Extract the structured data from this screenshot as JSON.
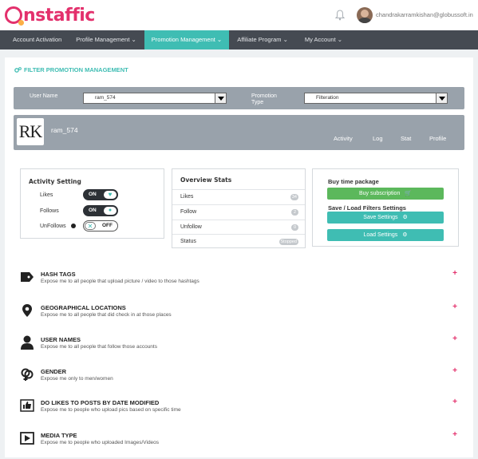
{
  "brand": {
    "logo_text": "nstaffic",
    "logo_icon": "instagram-ring-icon",
    "accent": "#e3306c"
  },
  "header": {
    "user_email": "chandrakarramkishan@globussoft.in",
    "bell_icon": "bell-icon"
  },
  "nav": {
    "items": [
      {
        "label": "Account Activation"
      },
      {
        "label": "Profile Management  ⌄"
      },
      {
        "label": "Promotion Management  ⌄"
      },
      {
        "label": "Affiliate Program  ⌄"
      },
      {
        "label": "My Account  ⌄"
      }
    ],
    "active_color": "#3fbdb3"
  },
  "filter": {
    "title": "FILTER PROMOTION MANAGEMENT",
    "user_name_label": "User Name",
    "user_name_value": "ram_574",
    "promotion_type_label": "Promotion Type",
    "promotion_type_value": "Filteration"
  },
  "profile": {
    "avatar_text": "RK",
    "name": "ram_574",
    "tabs": [
      "Activity",
      "Log",
      "Stat",
      "Profile"
    ]
  },
  "activity": {
    "title": "Activity Setting",
    "rows": [
      {
        "label": "Likes",
        "state": "ON"
      },
      {
        "label": "Follows",
        "state": "ON"
      },
      {
        "label": "UnFollows",
        "state": "OFF"
      }
    ]
  },
  "overview": {
    "title": "Overview Stats",
    "rows": [
      {
        "label": "Likes",
        "value": "34"
      },
      {
        "label": "Follow",
        "value": "2"
      },
      {
        "label": "Unfollow",
        "value": "0"
      },
      {
        "label": "Status",
        "value": "Stopped"
      }
    ]
  },
  "buy": {
    "title": "Buy time package",
    "subscribe_label": "Buy subscription",
    "save_load_title": "Save / Load Filters Settings",
    "save_label": "Save Settings",
    "load_label": "Load Settings",
    "green": "#5cb85c",
    "teal": "#3fbdb3"
  },
  "features": [
    {
      "title": "HASH TAGS",
      "desc": "Expose me to all people that upload picture / video to those hashtags",
      "icon": "tag-icon"
    },
    {
      "title": "GEOGRAPHICAL LOCATIONS",
      "desc": "Expose me to all people that did check in at those places",
      "icon": "map-pin-icon"
    },
    {
      "title": "USER NAMES",
      "desc": "Expose me to all people that follow those accounts",
      "icon": "user-icon"
    },
    {
      "title": "GENDER",
      "desc": "Expose me only to men/women",
      "icon": "gender-icon"
    },
    {
      "title": "DO LIKES TO POSTS BY DATE MODIFIED",
      "desc": "Expose me to people who upload pics based on specific time",
      "icon": "like-post-icon"
    },
    {
      "title": "MEDIA TYPE",
      "desc": "Expose me to people who uploaded Images/Videos",
      "icon": "media-play-icon"
    }
  ],
  "plus_symbol": "+"
}
